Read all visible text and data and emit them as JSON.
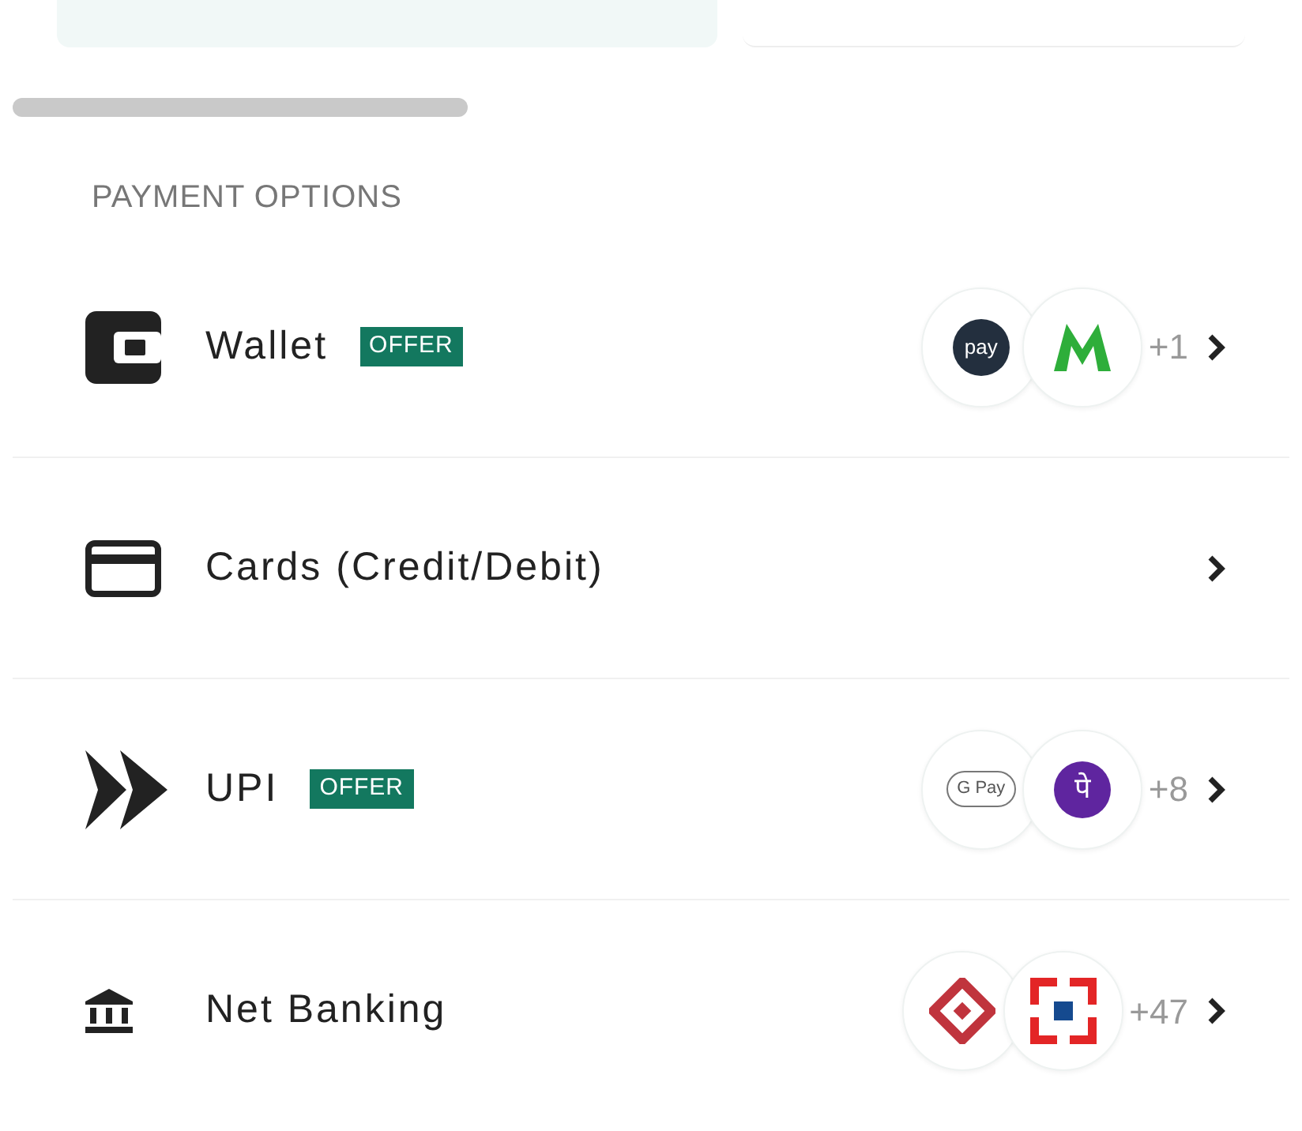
{
  "section_title": "PAYMENT OPTIONS",
  "options": [
    {
      "kind": "wallet",
      "label": "Wallet",
      "badge": "OFFER",
      "logos": [
        {
          "kind": "amazon-pay",
          "text": "pay"
        },
        {
          "kind": "mobikwik"
        }
      ],
      "more": "+1"
    },
    {
      "kind": "card",
      "label": "Cards (Credit/Debit)"
    },
    {
      "kind": "upi",
      "label": "UPI",
      "badge": "OFFER",
      "logos": [
        {
          "kind": "gpay",
          "text": "G Pay"
        },
        {
          "kind": "phonepe",
          "text": "पे"
        }
      ],
      "more": "+8"
    },
    {
      "kind": "bank",
      "label": "Net Banking",
      "logos": [
        {
          "kind": "diamond-bank"
        },
        {
          "kind": "square-bank"
        }
      ],
      "more": "+47"
    }
  ]
}
